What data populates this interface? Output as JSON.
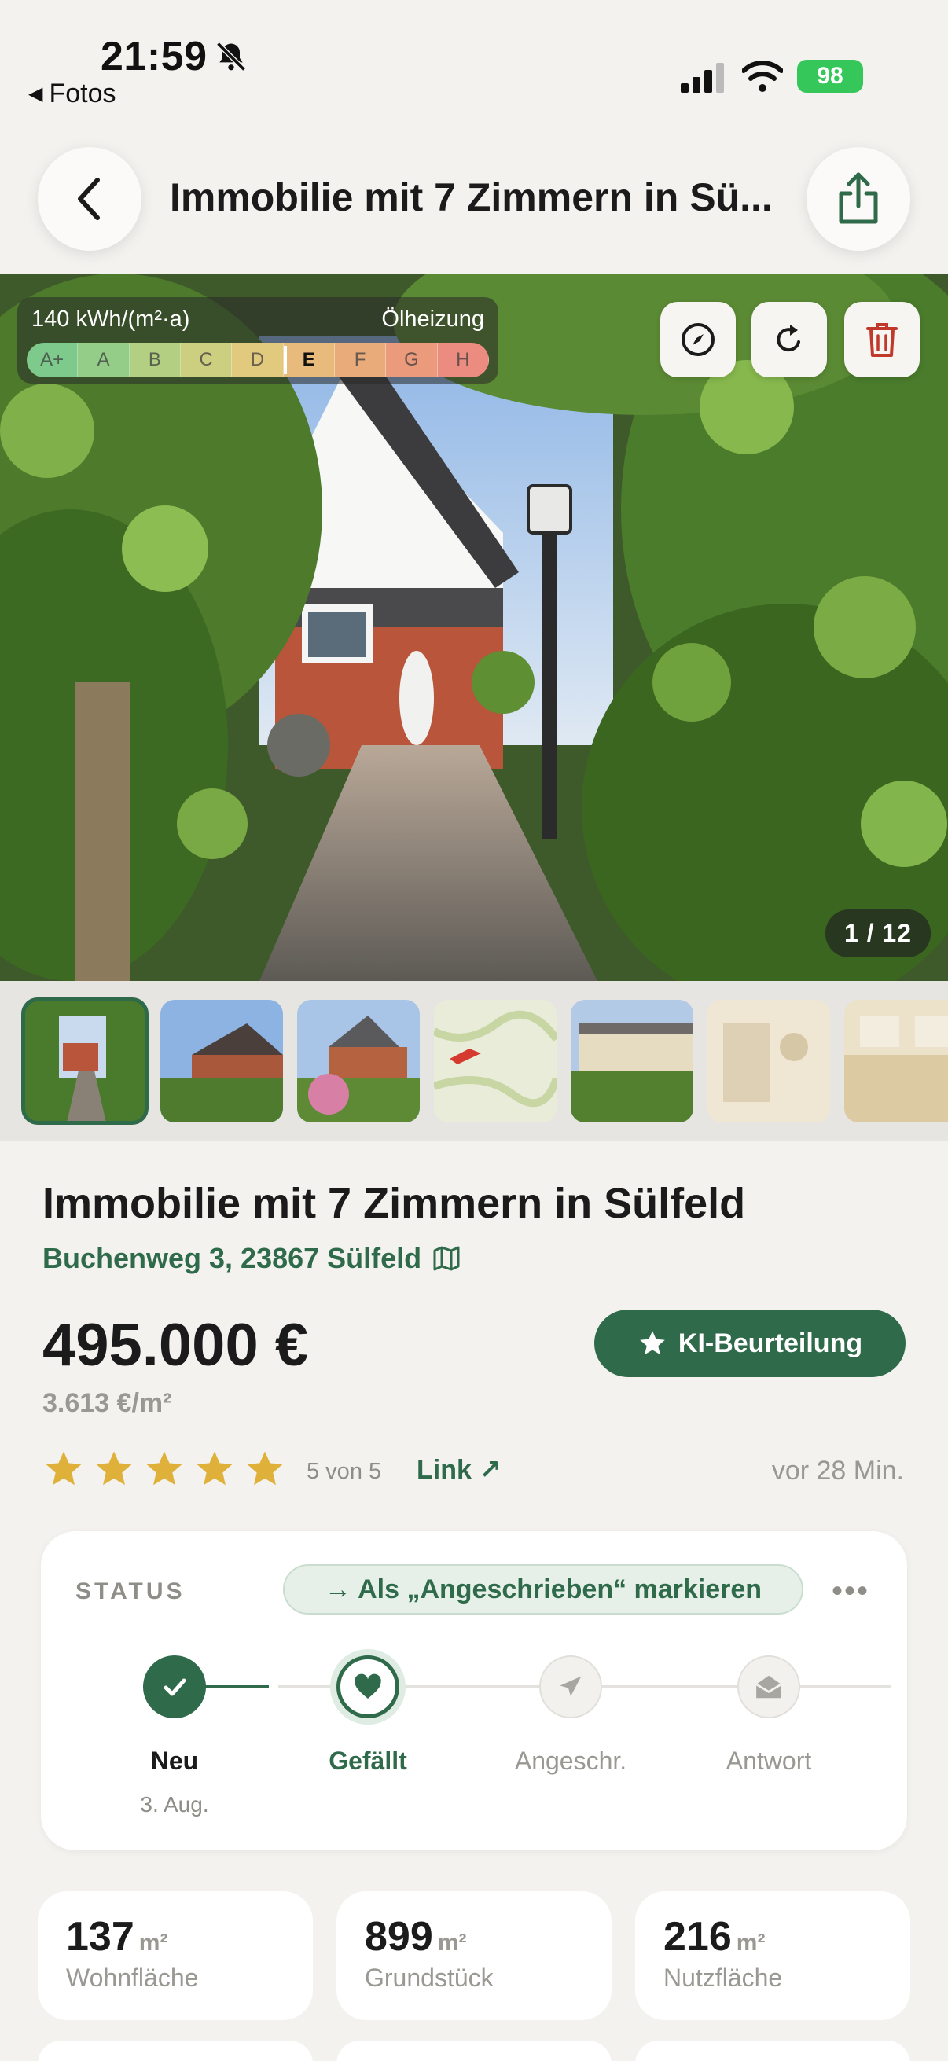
{
  "status_bar": {
    "time": "21:59",
    "back_app": "Fotos",
    "battery": "98"
  },
  "nav": {
    "title": "Immobilie mit 7 Zimmern in Sü..."
  },
  "photo": {
    "energy_value": "140 kWh/(m²·a)",
    "heating": "Ölheizung",
    "energy_classes": [
      "A+",
      "A",
      "B",
      "C",
      "D",
      "E",
      "F",
      "G",
      "H"
    ],
    "energy_active": "E",
    "counter": "1 / 12"
  },
  "listing": {
    "title": "Immobilie mit 7 Zimmern in Sülfeld",
    "address": "Buchenweg 3, 23867 Sülfeld",
    "price": "495.000 €",
    "price_per_sqm": "3.613 €/m²",
    "ki_button": "KI-Beurteilung",
    "rating": 5,
    "rating_text": "5 von 5",
    "link_label": "Link ↗",
    "time_ago": "vor 28 Min."
  },
  "status": {
    "label": "STATUS",
    "mark_button": "→ Als „Angeschrieben“ markieren",
    "more": "•••",
    "steps": [
      {
        "label": "Neu",
        "date": "3. Aug."
      },
      {
        "label": "Gefällt",
        "date": ""
      },
      {
        "label": "Angeschr.",
        "date": ""
      },
      {
        "label": "Antwort",
        "date": ""
      }
    ]
  },
  "metrics": [
    {
      "value": "137",
      "unit": "m²",
      "label": "Wohnfläche"
    },
    {
      "value": "899",
      "unit": "m²",
      "label": "Grundstück"
    },
    {
      "value": "216",
      "unit": "m²",
      "label": "Nutzfläche"
    }
  ],
  "colors": {
    "accent": "#2f6b4a",
    "background": "#f3f2ef",
    "star": "#e0b13a",
    "delete": "#c0392b"
  }
}
